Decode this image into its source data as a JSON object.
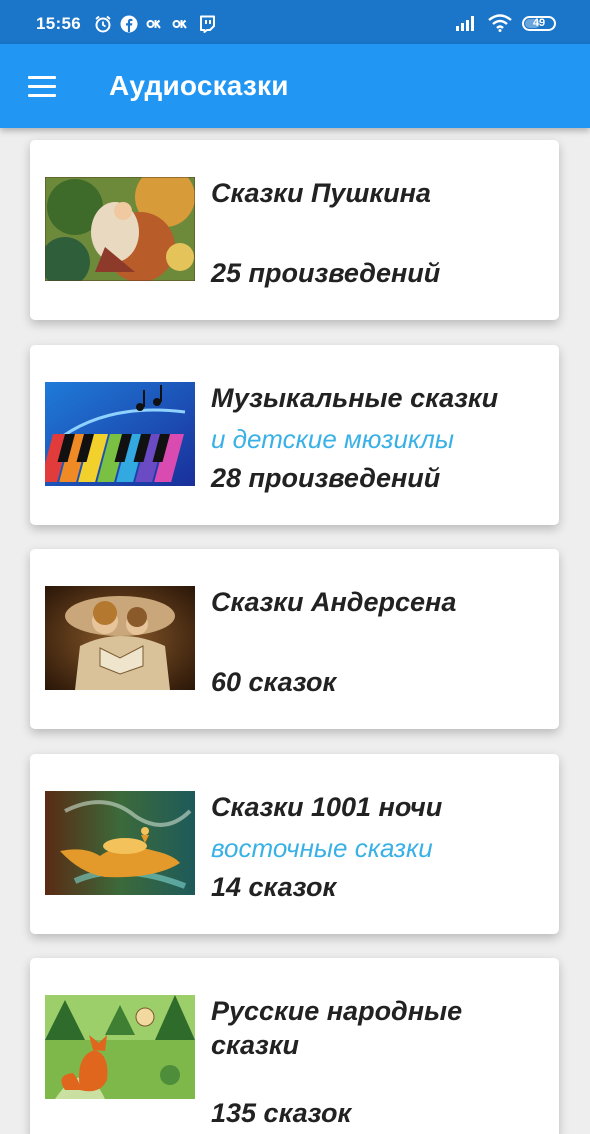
{
  "status_bar": {
    "time": "15:56",
    "left_icons": [
      "alarm-icon",
      "facebook-icon",
      "ok-icon",
      "ok-icon",
      "twitch-icon"
    ],
    "right_icons": [
      "signal-icon",
      "wifi-icon",
      "battery-icon"
    ],
    "battery_level": "49"
  },
  "app_bar": {
    "title": "Аудиосказки",
    "menu_icon": "menu-icon",
    "background": "#2196f3"
  },
  "colors": {
    "status_bar": "#1b75c9",
    "subtitle": "#3ab1e6",
    "text": "#222222"
  },
  "items": [
    {
      "title": "Сказки Пушкина",
      "subtitle": "",
      "count": "25 произведений",
      "thumb": "pushkin-fairy-tales-picture"
    },
    {
      "title": "Музыкальные сказки",
      "subtitle": "и детские мюзиклы",
      "count": "28 произведений",
      "thumb": "musical-piano-keys-picture"
    },
    {
      "title": "Сказки Андерсена",
      "subtitle": "",
      "count": "60 сказок",
      "thumb": "children-reading-book-picture"
    },
    {
      "title": "Сказки 1001 ночи",
      "subtitle": "восточные сказки",
      "count": "14 сказок",
      "thumb": "magic-lamp-picture"
    },
    {
      "title": "Русские народные сказки",
      "subtitle": "",
      "count": "135 сказок",
      "thumb": "fox-in-forest-picture"
    }
  ]
}
